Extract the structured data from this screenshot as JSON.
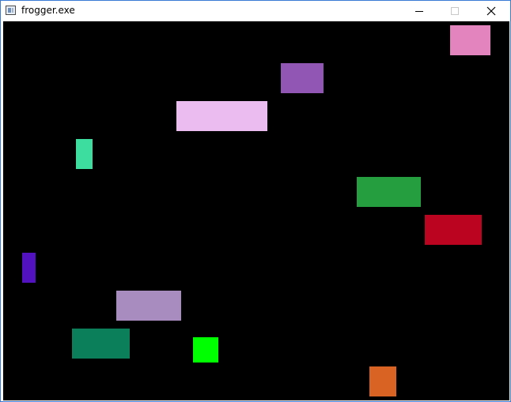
{
  "window": {
    "title": "frogger.exe",
    "icon": "app-window-icon",
    "controls": [
      "minimize-icon",
      "maximize-icon",
      "close-icon"
    ]
  },
  "game": {
    "background": "#000000",
    "player": {
      "name": "frog",
      "color": "#00ff00"
    },
    "obstacles": [
      {
        "name": "pink-block",
        "color": "#e384bf"
      },
      {
        "name": "purple-block",
        "color": "#9155b3"
      },
      {
        "name": "lavender-block",
        "color": "#ebbcef"
      },
      {
        "name": "teal-block",
        "color": "#3ddc9f"
      },
      {
        "name": "green-block",
        "color": "#249e3f"
      },
      {
        "name": "red-block",
        "color": "#bb041f"
      },
      {
        "name": "indigo-block",
        "color": "#5212bf"
      },
      {
        "name": "mauve-block",
        "color": "#a98cbf"
      },
      {
        "name": "dark-green-block",
        "color": "#0b7e5a"
      },
      {
        "name": "orange-block",
        "color": "#d96323"
      }
    ]
  }
}
